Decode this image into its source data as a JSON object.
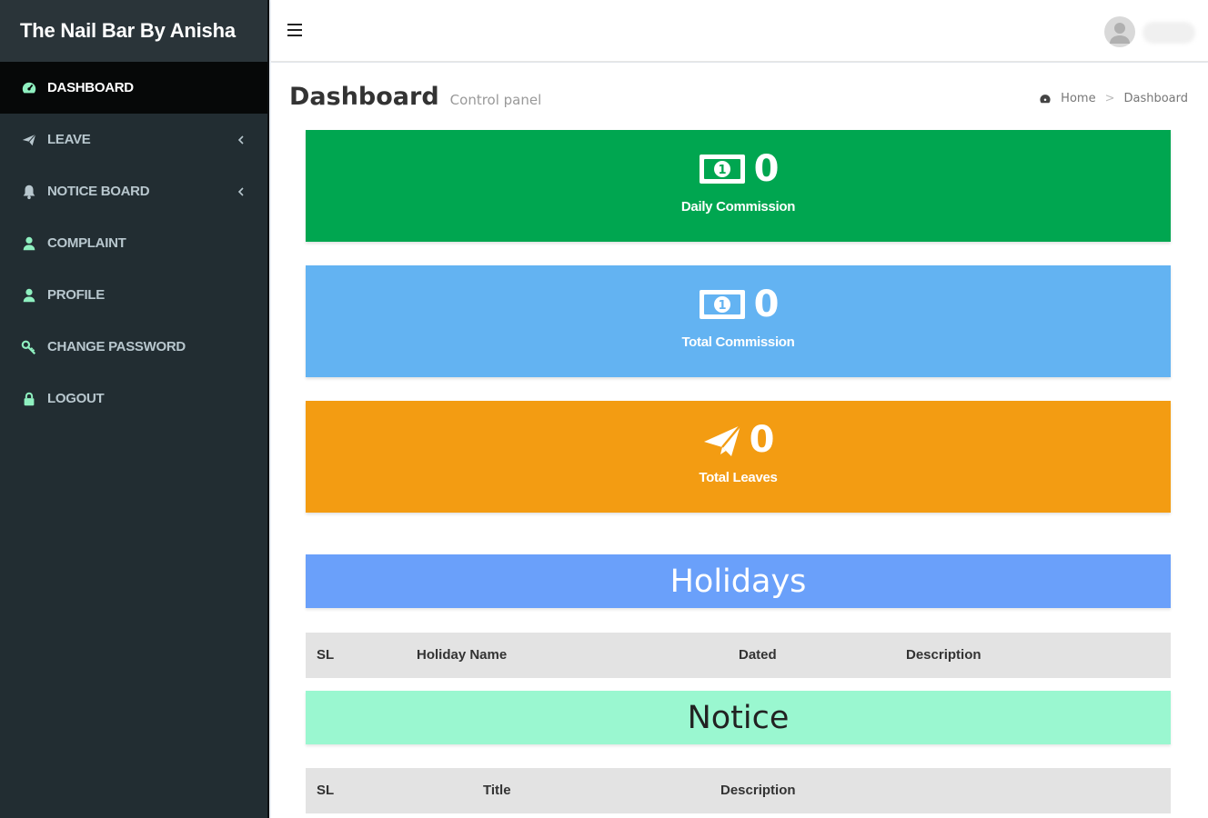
{
  "app": {
    "brand": "The Nail Bar By Anisha"
  },
  "sidebar": {
    "items": [
      {
        "label": "DASHBOARD",
        "icon": "dashboard-icon",
        "active": true
      },
      {
        "label": "LEAVE",
        "icon": "paper-plane-icon",
        "has_children": true
      },
      {
        "label": "NOTICE BOARD",
        "icon": "bell-icon",
        "has_children": true
      },
      {
        "label": "COMPLAINT",
        "icon": "user-icon"
      },
      {
        "label": "PROFILE",
        "icon": "user-icon"
      },
      {
        "label": "CHANGE PASSWORD",
        "icon": "key-icon"
      },
      {
        "label": "LOGOUT",
        "icon": "lock-icon"
      }
    ]
  },
  "header": {
    "title": "Dashboard",
    "subtitle": "Control panel",
    "breadcrumb": [
      "Home",
      "Dashboard"
    ]
  },
  "stats": [
    {
      "value": "0",
      "label": "Daily Commission",
      "icon": "money-icon",
      "color": "#00a650"
    },
    {
      "value": "0",
      "label": "Total Commission",
      "icon": "money-icon",
      "color": "#63b3f2"
    },
    {
      "value": "0",
      "label": "Total Leaves",
      "icon": "paper-plane-icon",
      "color": "#f39c12"
    }
  ],
  "holidays": {
    "title": "Holidays",
    "columns": [
      "SL",
      "Holiday Name",
      "Dated",
      "Description"
    ],
    "rows": []
  },
  "notice": {
    "title": "Notice",
    "columns": [
      "SL",
      "Title",
      "Description"
    ],
    "rows": []
  },
  "colors": {
    "sidebar_bg": "#222d32",
    "holidays_header": "#6aa0fa",
    "notice_header": "#9af7d0",
    "sidebar_icon": "#8ff0c0"
  }
}
